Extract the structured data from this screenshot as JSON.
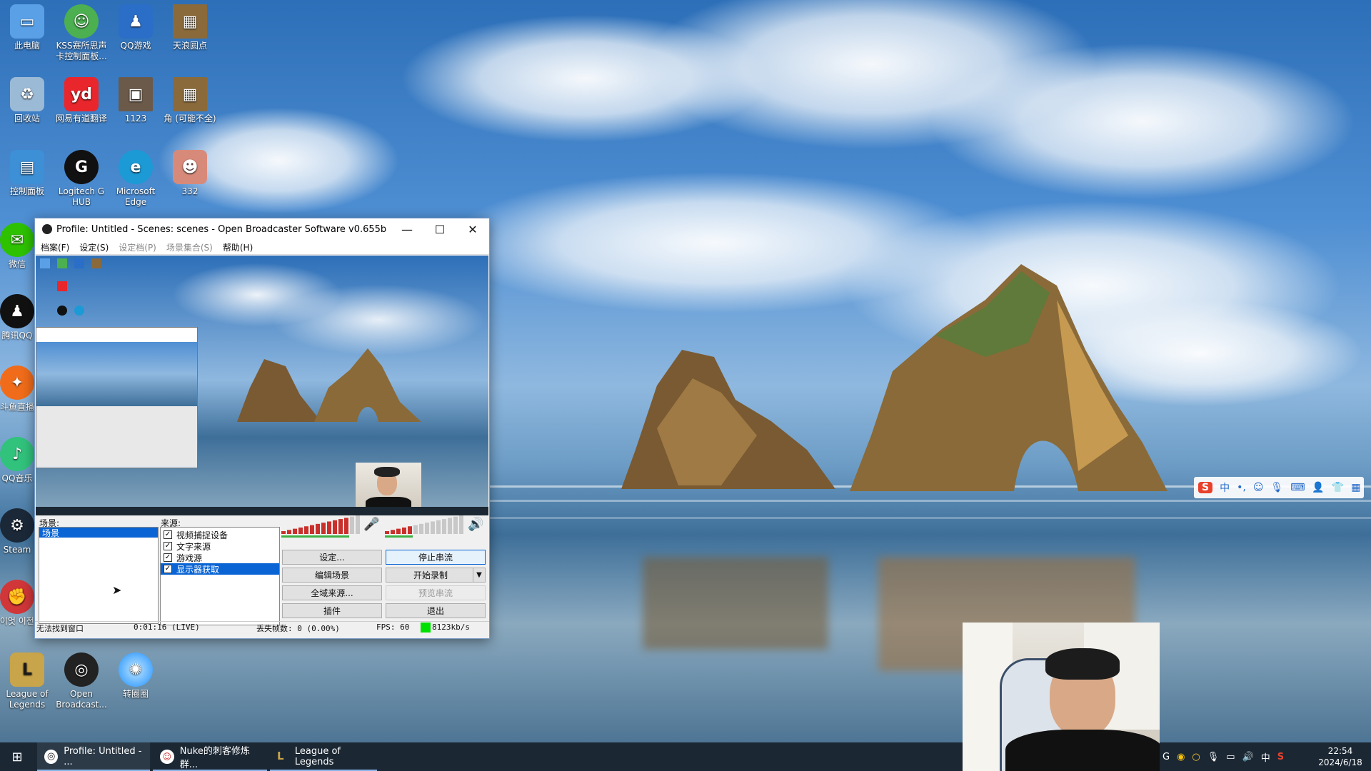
{
  "desktop": {
    "icons": [
      {
        "label": "此电脑",
        "icon": "computer-icon",
        "color": "#5aa0e6"
      },
      {
        "label": "KSS赛所思声卡控制面板...",
        "icon": "kss-frog-icon",
        "color": "#4caf50"
      },
      {
        "label": "QQ游戏",
        "icon": "qq-game-penguin-icon",
        "color": "#2b6ec7"
      },
      {
        "label": "天浪圆点",
        "icon": "map-thumbnail-icon",
        "color": "#8a6a3a"
      },
      {
        "label": "回收站",
        "icon": "recycle-bin-icon",
        "color": "#9bbad6"
      },
      {
        "label": "网易有道翻译",
        "icon": "youdao-icon",
        "color": "#e8262c",
        "glyph": "yd"
      },
      {
        "label": "1123",
        "icon": "photo-thumbnail-icon",
        "color": "#6b5a4a"
      },
      {
        "label": "角 (可能不全)",
        "icon": "map-thumbnail-icon",
        "color": "#8a6a3a"
      },
      {
        "label": "控制面板",
        "icon": "control-panel-icon",
        "color": "#3d8fd6"
      },
      {
        "label": "Logitech G HUB",
        "icon": "logitech-g-icon",
        "color": "#111111",
        "glyph": "G"
      },
      {
        "label": "Microsoft Edge",
        "icon": "edge-icon",
        "color": "#1b9ad6"
      },
      {
        "label": "332",
        "icon": "anime-avatar-icon",
        "color": "#d88a7a"
      },
      {
        "label": "微信",
        "icon": "wechat-icon",
        "color": "#2dc100"
      },
      {
        "label": "腾讯QQ",
        "icon": "qq-penguin-icon",
        "color": "#111111"
      },
      {
        "label": "斗鱼直播",
        "icon": "douyu-icon",
        "color": "#f06c1a"
      },
      {
        "label": "QQ音乐",
        "icon": "qq-music-icon",
        "color": "#31c27c"
      },
      {
        "label": "Steam",
        "icon": "steam-icon",
        "color": "#1b2838"
      },
      {
        "label": "라이엇 이전...",
        "icon": "riot-icon",
        "color": "#d13639"
      },
      {
        "label": "League of Legends",
        "icon": "league-icon",
        "color": "#c8a44a",
        "glyph": "L"
      },
      {
        "label": "Open Broadcast...",
        "icon": "obs-icon",
        "color": "#222222"
      },
      {
        "label": "转圈圈",
        "icon": "orb-icon",
        "color": "#1e90ff"
      }
    ]
  },
  "obs": {
    "title": "Profile: Untitled - Scenes: scenes - Open Broadcaster Software v0.655b",
    "menu": [
      {
        "label": "档案(F)",
        "enabled": true
      },
      {
        "label": "设定(S)",
        "enabled": true
      },
      {
        "label": "设定档(P)",
        "enabled": false
      },
      {
        "label": "场景集合(S)",
        "enabled": false
      },
      {
        "label": "帮助(H)",
        "enabled": true
      }
    ],
    "scenes_label": "场景:",
    "scenes": [
      "场景"
    ],
    "sources_label": "来源:",
    "sources": [
      {
        "label": "视频捕捉设备",
        "checked": true,
        "selected": false
      },
      {
        "label": "文字来源",
        "checked": true,
        "selected": false
      },
      {
        "label": "游戏源",
        "checked": true,
        "selected": false
      },
      {
        "label": "显示器获取",
        "checked": true,
        "selected": true
      }
    ],
    "mic_level": 0.85,
    "desktop_level": 0.35,
    "buttons": {
      "settings": "设定...",
      "stop_stream": "停止串流",
      "edit_scene": "编辑场景",
      "start_record": "开始录制",
      "global_sources": "全域来源...",
      "preview_stream": "预览串流",
      "plugins": "插件",
      "exit": "退出"
    },
    "status": {
      "message": "无法找到窗口",
      "time": "0:01:16 (LIVE)",
      "dropped": "丢失帧数: 0 (0.00%)",
      "fps": "FPS: 60",
      "bitrate": "8123kb/s",
      "bitrate_color": "#00e000"
    }
  },
  "ime": {
    "logo": "S",
    "mode": "中",
    "punct": "•,"
  },
  "taskbar": {
    "items": [
      {
        "label": "Profile: Untitled - ...",
        "icon": "obs-icon",
        "active": true
      },
      {
        "label": "Nuke的刺客修炼群...",
        "icon": "chat-icon",
        "active": true
      },
      {
        "label": "League of Legends",
        "icon": "league-icon",
        "active": true
      }
    ],
    "ime_indicator": "中",
    "time": "22:54",
    "date": "2024/6/18"
  }
}
